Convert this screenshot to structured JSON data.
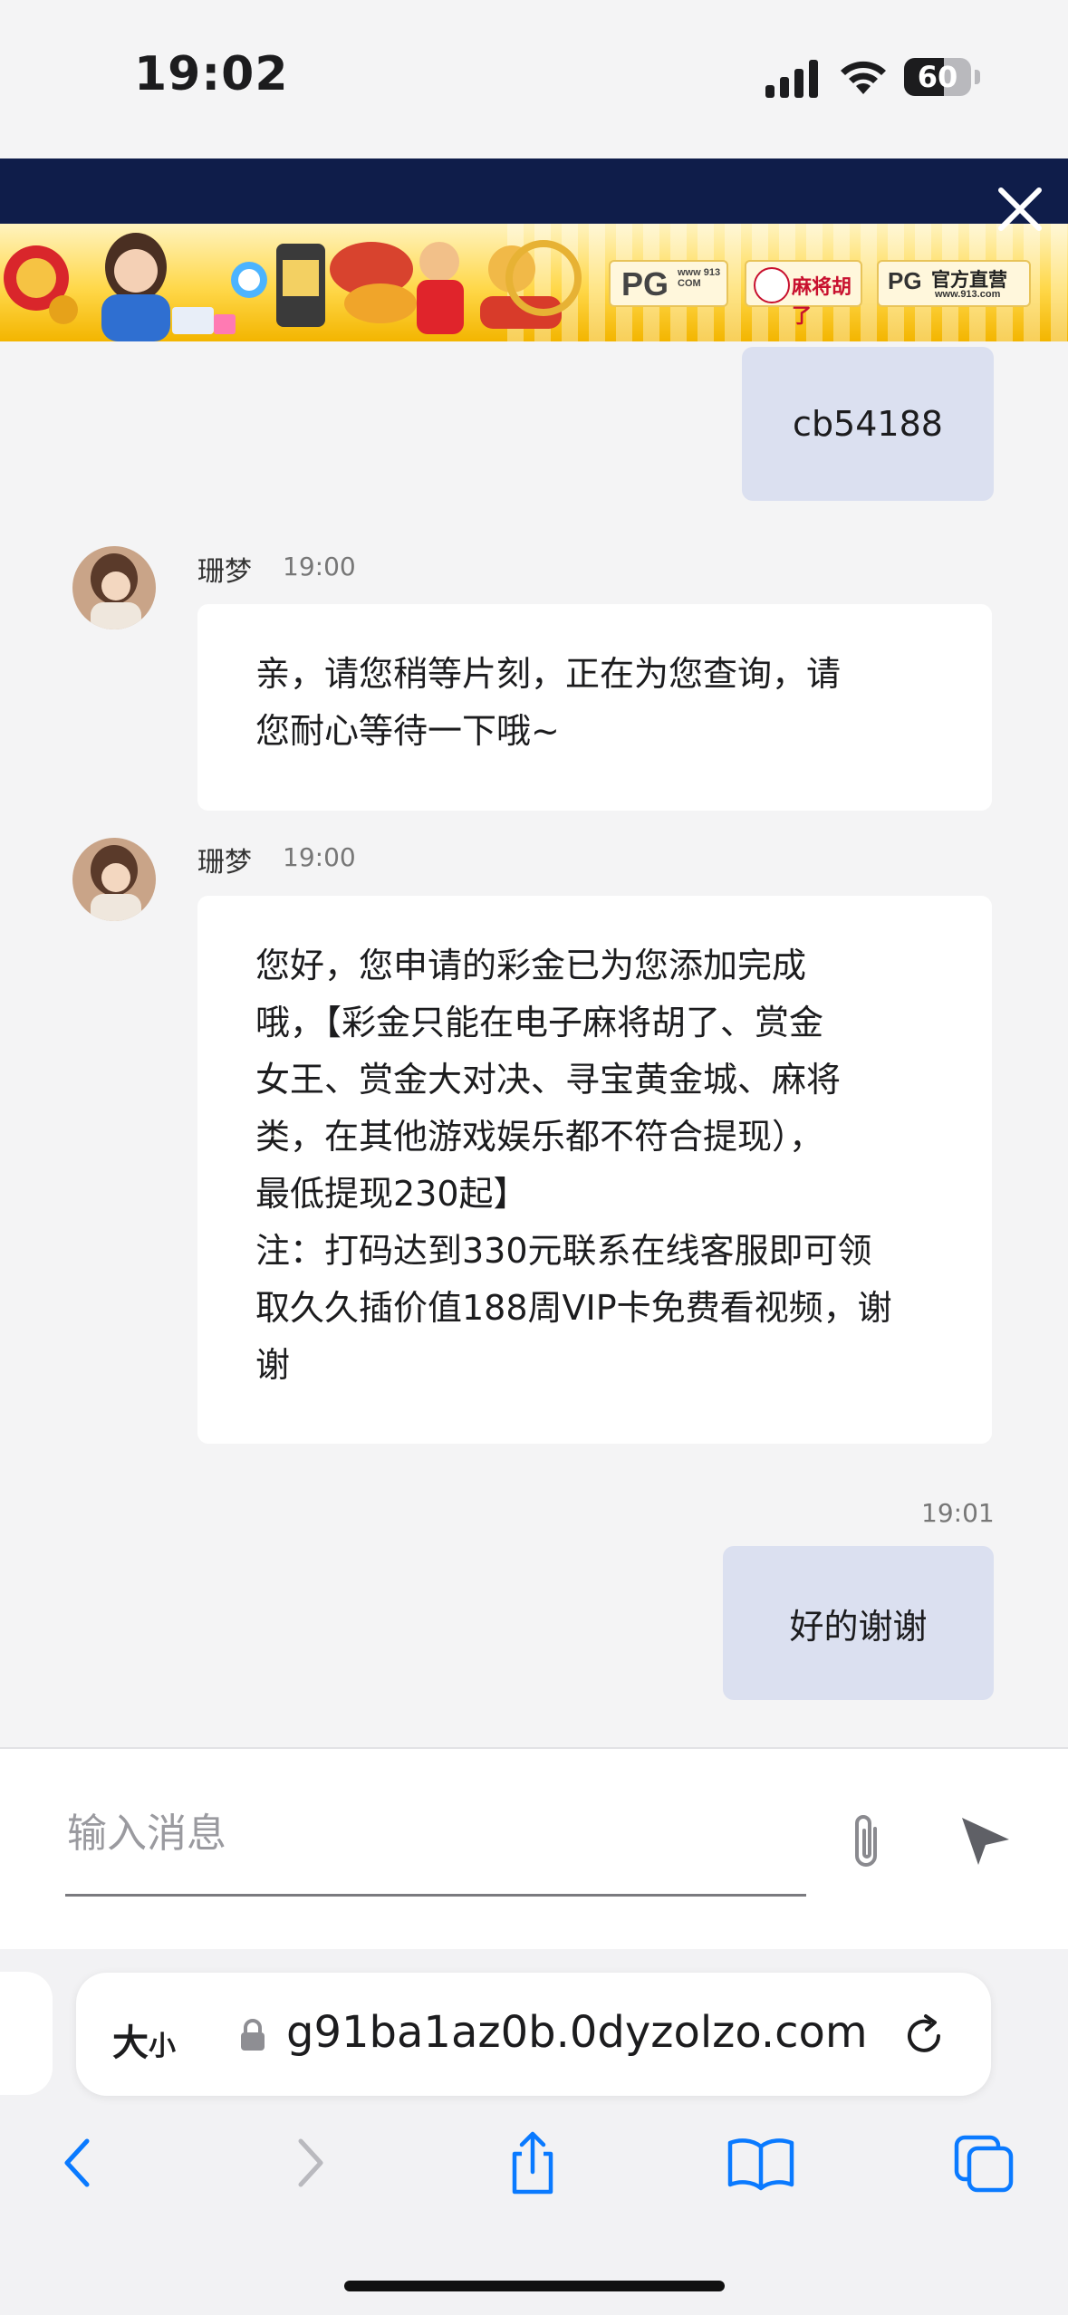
{
  "status_bar": {
    "time": "19:02",
    "battery": "60",
    "battery_fraction": 0.6
  },
  "banner": {
    "logo1_big": "PG",
    "logo1_small": "www 913 COM",
    "logo2": "麻将胡了",
    "logo3_big": "PG",
    "logo3_cn": "官方直营",
    "logo3_url": "www.913.com"
  },
  "chat": {
    "messages": [
      {
        "side": "right",
        "text": "cb54188"
      },
      {
        "side": "left",
        "sender": "珊梦",
        "time": "19:00",
        "text": "亲，请您稍等片刻，正在为您查询，请\n您耐心等待一下哦~"
      },
      {
        "side": "left",
        "sender": "珊梦",
        "time": "19:00",
        "text": "您好，您申请的彩金已为您添加完成\n哦，【彩金只能在电子麻将胡了、赏金\n女王、赏金大对决、寻宝黄金城、麻将\n类，在其他游戏娱乐都不符合提现），\n最低提现230起】\n注：打码达到330元联系在线客服即可领\n取久久插价值188周VIP卡免费看视频，谢\n谢"
      },
      {
        "side": "right",
        "time": "19:01",
        "text": "好的谢谢"
      }
    ]
  },
  "input": {
    "placeholder": "输入消息",
    "value": ""
  },
  "browser": {
    "text_size_big": "大",
    "text_size_small": "小",
    "url": "g91ba1az0b.0dyzolzo.com"
  }
}
